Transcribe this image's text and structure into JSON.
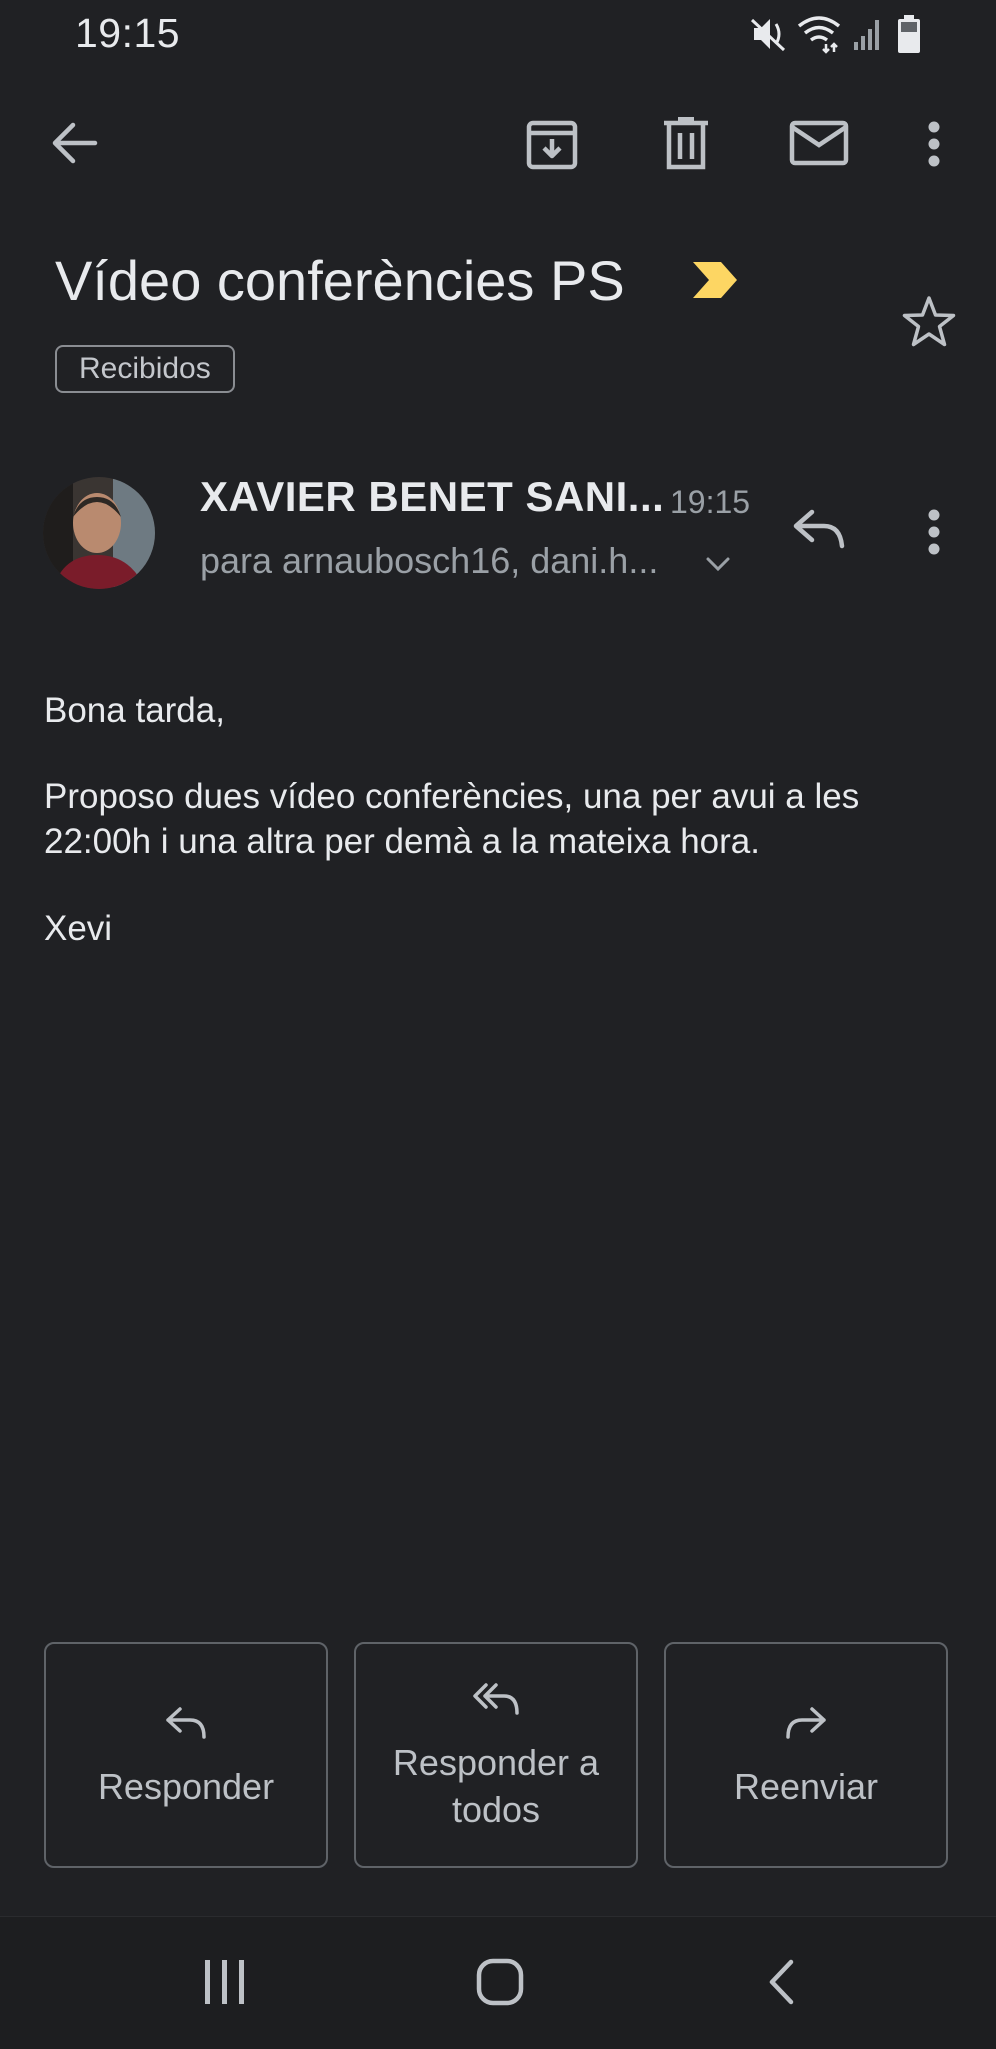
{
  "status_bar": {
    "time": "19:15",
    "icons": [
      "mute-icon",
      "wifi-icon",
      "signal-icon",
      "battery-icon"
    ]
  },
  "toolbar": {
    "icons": [
      "back-arrow-icon",
      "archive-icon",
      "delete-icon",
      "mark-unread-icon",
      "more-vert-icon"
    ]
  },
  "email": {
    "subject": "Vídeo conferències PS",
    "importance_icon": "importance-marker-icon",
    "importance_color": "#fdd663",
    "label": "Recibidos",
    "sender": "XAVIER BENET SANI...",
    "time": "19:15",
    "recipients": "para arnaubosch16, dani.h...",
    "body": {
      "greeting": "Bona tarda,",
      "line1": "Proposo dues vídeo conferències, una per avui a les",
      "line2": "22:00h i una altra per demà a la mateixa hora.",
      "signature": "Xevi"
    }
  },
  "actions": {
    "reply": "Responder",
    "reply_all_line1": "Responder a",
    "reply_all_line2": "todos",
    "forward": "Reenviar"
  },
  "colors": {
    "background": "#202124",
    "text": "#e8eaed",
    "secondary_text": "#9aa0a6"
  }
}
